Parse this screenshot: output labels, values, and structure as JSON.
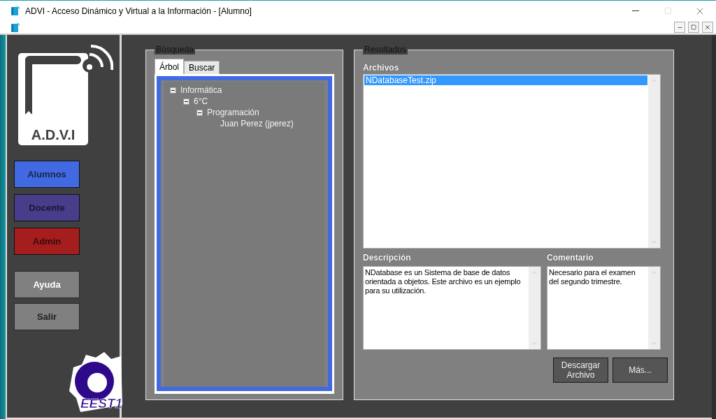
{
  "window": {
    "title": "ADVI - Acceso Dinámico y Virtual a la Información - [Alumno]"
  },
  "sidebar": {
    "logo_text": "A.D.V.I",
    "nav": [
      {
        "label": "Alumnos",
        "color": "#4169e1"
      },
      {
        "label": "Docente",
        "color": "#483d8b"
      },
      {
        "label": "Admin",
        "color": "#a51d1d"
      }
    ],
    "utility": [
      {
        "label": "Ayuda",
        "hovered": true
      },
      {
        "label": "Salir",
        "hovered": false
      }
    ],
    "school_logo_text": "EEST1"
  },
  "search": {
    "title": "Búsqueda",
    "tabs": [
      {
        "label": "Árbol",
        "selected": true
      },
      {
        "label": "Buscar",
        "selected": false
      }
    ],
    "tree": [
      {
        "label": "Informática",
        "expanded": true,
        "children": [
          {
            "label": "6°C",
            "expanded": true,
            "children": [
              {
                "label": "Programación",
                "expanded": true,
                "children": [
                  {
                    "label": "Juan Perez (jperez)"
                  }
                ]
              }
            ]
          }
        ]
      }
    ]
  },
  "results": {
    "title": "Resultados",
    "files_label": "Archivos",
    "files": [
      {
        "name": "NDatabaseTest.zip",
        "selected": true
      }
    ],
    "description": {
      "label": "Descripción",
      "value": "NDatabase es un Sistema de base de datos orientada a objetos. Este archivo es un ejemplo para su utilización."
    },
    "comment": {
      "label": "Comentario",
      "value": "Necesario para el examen del segundo trimestre."
    },
    "buttons": [
      "Descargar Archivo",
      "Más..."
    ]
  }
}
